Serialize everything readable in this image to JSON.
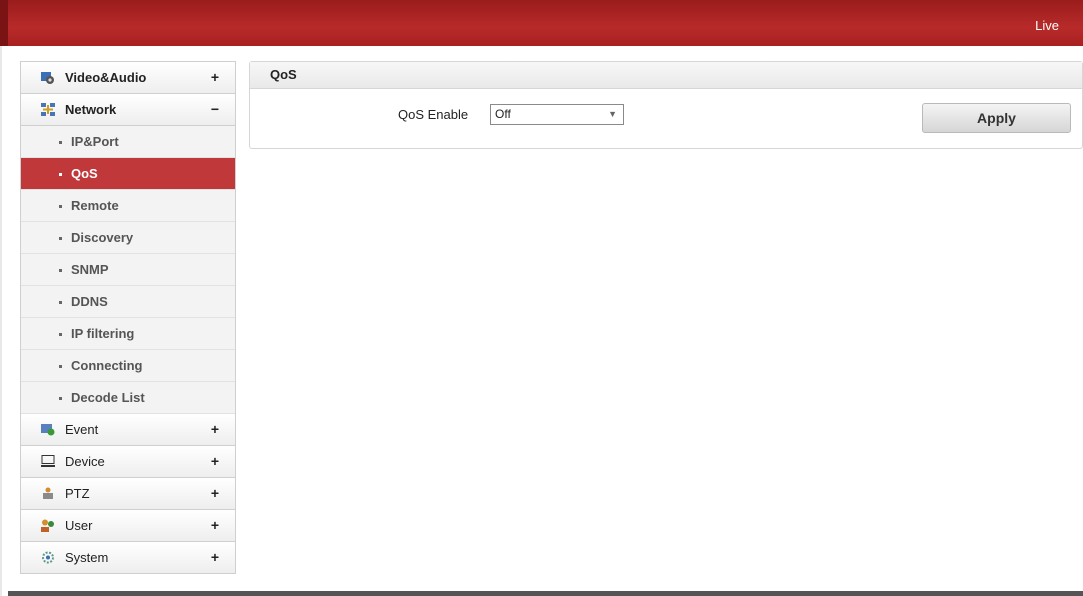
{
  "header": {
    "live_label": "Live",
    "brand_color": "#b02525"
  },
  "sidebar": {
    "video_audio": {
      "label": "Video&Audio",
      "toggle": "+",
      "icon": "video-audio-icon"
    },
    "network": {
      "label": "Network",
      "toggle": "−",
      "icon": "network-icon"
    },
    "network_items": [
      {
        "label": "IP&Port"
      },
      {
        "label": "QoS",
        "active": true
      },
      {
        "label": "Remote"
      },
      {
        "label": "Discovery"
      },
      {
        "label": "SNMP"
      },
      {
        "label": "DDNS"
      },
      {
        "label": "IP filtering"
      },
      {
        "label": "Connecting"
      },
      {
        "label": "Decode List"
      }
    ],
    "event": {
      "label": "Event",
      "toggle": "+",
      "icon": "event-icon"
    },
    "device": {
      "label": "Device",
      "toggle": "+",
      "icon": "monitor-icon"
    },
    "ptz": {
      "label": "PTZ",
      "toggle": "+",
      "icon": "ptz-icon"
    },
    "user": {
      "label": "User",
      "toggle": "+",
      "icon": "users-icon"
    },
    "system": {
      "label": "System",
      "toggle": "+",
      "icon": "system-gear-icon"
    }
  },
  "main": {
    "panel_title": "QoS",
    "qos_enable_label": "QoS Enable",
    "qos_enable_value": "Off",
    "apply_label": "Apply"
  }
}
